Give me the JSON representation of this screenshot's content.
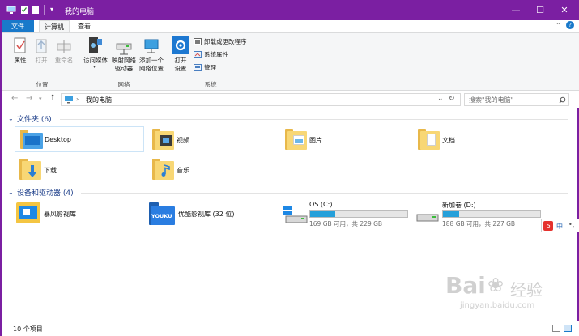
{
  "window": {
    "title": "我的电脑",
    "accent": "#7b1fa2"
  },
  "title_controls": {
    "minimize": "—",
    "maximize": "☐",
    "close": "✕"
  },
  "tabs": {
    "file": "文件",
    "computer": "计算机",
    "view": "查看"
  },
  "ribbon": {
    "location": {
      "properties": "属性",
      "open": "打开",
      "rename": "重命名",
      "label": "位置"
    },
    "network": {
      "access_media": "访问媒体",
      "map_drive_1": "映射网络",
      "map_drive_2": "驱动器",
      "add_location_1": "添加一个",
      "add_location_2": "网络位置",
      "label": "网络"
    },
    "system": {
      "open_settings_1": "打开",
      "open_settings_2": "设置",
      "uninstall": "卸载或更改程序",
      "system_properties": "系统属性",
      "manage": "管理",
      "label": "系统"
    }
  },
  "address": {
    "path": "我的电脑",
    "search_placeholder": "搜索\"我的电脑\""
  },
  "folders_section": {
    "header": "文件夹 (6)",
    "items": [
      {
        "name": "Desktop",
        "icon": "desktop-folder-icon"
      },
      {
        "name": "视频",
        "icon": "video-folder-icon"
      },
      {
        "name": "图片",
        "icon": "pictures-folder-icon"
      },
      {
        "name": "文档",
        "icon": "documents-folder-icon"
      },
      {
        "name": "下载",
        "icon": "downloads-folder-icon"
      },
      {
        "name": "音乐",
        "icon": "music-folder-icon"
      }
    ]
  },
  "devices_section": {
    "header": "设备和驱动器 (4)",
    "items": [
      {
        "name": "暴风影视库",
        "icon": "baofeng-library-icon"
      },
      {
        "name": "优酷影视库 (32 位)",
        "icon": "youku-library-icon",
        "logo_text": "YOUKU"
      },
      {
        "name": "OS (C:)",
        "free": "169 GB 可用，共 229 GB",
        "used_fraction": 0.26,
        "icon": "windows-drive-icon"
      },
      {
        "name": "新加卷 (D:)",
        "free": "188 GB 可用，共 227 GB",
        "used_fraction": 0.17,
        "icon": "drive-icon"
      }
    ]
  },
  "status": {
    "count": "10 个项目"
  },
  "ime": {
    "text": "中"
  },
  "watermark": {
    "brand": "Bai",
    "brand_tail": "经验",
    "url": "jingyan.baidu.com"
  },
  "colors": {
    "drive_fill": "#26a0da",
    "file_tab": "#1979ca",
    "section_header": "#1e3f8a"
  }
}
